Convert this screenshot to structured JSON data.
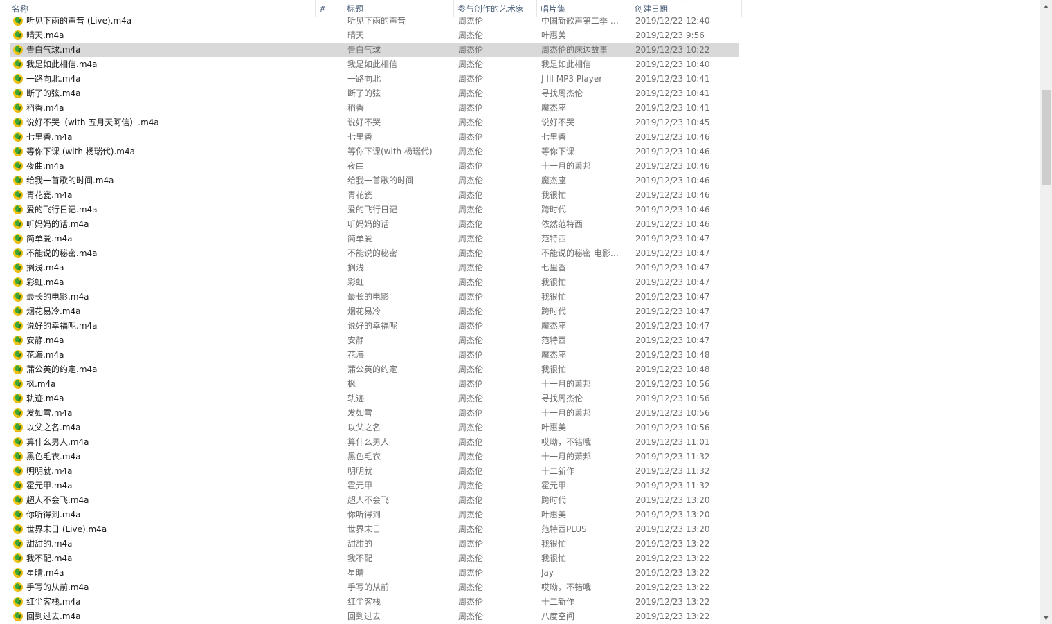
{
  "header": {
    "col_name": "名称",
    "col_number": "#",
    "col_title": "标题",
    "col_artists": "参与创作的艺术家",
    "col_album": "唱片集",
    "col_created": "创建日期",
    "sort_arrow": "⌃"
  },
  "scrollbar": {
    "up": "▲",
    "down": "▼",
    "position_fraction": 0.18
  },
  "colors": {
    "selected_row": "#d9d9d9",
    "header_text": "#4c607a",
    "icon": "qq-music-file-icon"
  },
  "rows": [
    {
      "name": "听见下雨的声音 (Live).m4a",
      "title": "听见下雨的声音",
      "artist": "周杰伦",
      "album": "中国新歌声第二季 第...",
      "date": "2019/12/22 12:40"
    },
    {
      "name": "晴天.m4a",
      "title": "晴天",
      "artist": "周杰伦",
      "album": "叶惠美",
      "date": "2019/12/23 9:56"
    },
    {
      "name": "告白气球.m4a",
      "title": "告白气球",
      "artist": "周杰伦",
      "album": "周杰伦的床边故事",
      "date": "2019/12/23 10:22",
      "selected": true
    },
    {
      "name": "我是如此相信.m4a",
      "title": "我是如此相信",
      "artist": "周杰伦",
      "album": "我是如此相信",
      "date": "2019/12/23 10:40"
    },
    {
      "name": "一路向北.m4a",
      "title": "一路向北",
      "artist": "周杰伦",
      "album": "J III MP3 Player",
      "date": "2019/12/23 10:41"
    },
    {
      "name": "断了的弦.m4a",
      "title": "断了的弦",
      "artist": "周杰伦",
      "album": "寻找周杰伦",
      "date": "2019/12/23 10:41"
    },
    {
      "name": "稻香.m4a",
      "title": "稻香",
      "artist": "周杰伦",
      "album": "魔杰座",
      "date": "2019/12/23 10:41"
    },
    {
      "name": "说好不哭（with 五月天阿信）.m4a",
      "title": "说好不哭",
      "artist": "周杰伦",
      "album": "说好不哭",
      "date": "2019/12/23 10:45"
    },
    {
      "name": "七里香.m4a",
      "title": "七里香",
      "artist": "周杰伦",
      "album": "七里香",
      "date": "2019/12/23 10:46"
    },
    {
      "name": "等你下课 (with 杨瑞代).m4a",
      "title": "等你下课(with 杨瑞代)",
      "artist": "周杰伦",
      "album": "等你下课",
      "date": "2019/12/23 10:46"
    },
    {
      "name": "夜曲.m4a",
      "title": "夜曲",
      "artist": "周杰伦",
      "album": "十一月的萧邦",
      "date": "2019/12/23 10:46"
    },
    {
      "name": "给我一首歌的时间.m4a",
      "title": "给我一首歌的时间",
      "artist": "周杰伦",
      "album": "魔杰座",
      "date": "2019/12/23 10:46"
    },
    {
      "name": "青花瓷.m4a",
      "title": "青花瓷",
      "artist": "周杰伦",
      "album": "我很忙",
      "date": "2019/12/23 10:46"
    },
    {
      "name": "爱的飞行日记.m4a",
      "title": "爱的飞行日记",
      "artist": "周杰伦",
      "album": "跨时代",
      "date": "2019/12/23 10:46"
    },
    {
      "name": "听妈妈的话.m4a",
      "title": "听妈妈的话",
      "artist": "周杰伦",
      "album": "依然范特西",
      "date": "2019/12/23 10:46"
    },
    {
      "name": "简单爱.m4a",
      "title": "简单爱",
      "artist": "周杰伦",
      "album": "范特西",
      "date": "2019/12/23 10:47"
    },
    {
      "name": "不能说的秘密.m4a",
      "title": "不能说的秘密",
      "artist": "周杰伦",
      "album": "不能说的秘密 电影原...",
      "date": "2019/12/23 10:47"
    },
    {
      "name": "搁浅.m4a",
      "title": "搁浅",
      "artist": "周杰伦",
      "album": "七里香",
      "date": "2019/12/23 10:47"
    },
    {
      "name": "彩虹.m4a",
      "title": "彩虹",
      "artist": "周杰伦",
      "album": "我很忙",
      "date": "2019/12/23 10:47"
    },
    {
      "name": "最长的电影.m4a",
      "title": "最长的电影",
      "artist": "周杰伦",
      "album": "我很忙",
      "date": "2019/12/23 10:47"
    },
    {
      "name": "烟花易冷.m4a",
      "title": "烟花易冷",
      "artist": "周杰伦",
      "album": "跨时代",
      "date": "2019/12/23 10:47"
    },
    {
      "name": "说好的幸福呢.m4a",
      "title": "说好的幸福呢",
      "artist": "周杰伦",
      "album": "魔杰座",
      "date": "2019/12/23 10:47"
    },
    {
      "name": "安静.m4a",
      "title": "安静",
      "artist": "周杰伦",
      "album": "范特西",
      "date": "2019/12/23 10:47"
    },
    {
      "name": "花海.m4a",
      "title": "花海",
      "artist": "周杰伦",
      "album": "魔杰座",
      "date": "2019/12/23 10:48"
    },
    {
      "name": "蒲公英的约定.m4a",
      "title": "蒲公英的约定",
      "artist": "周杰伦",
      "album": "我很忙",
      "date": "2019/12/23 10:48"
    },
    {
      "name": "枫.m4a",
      "title": "枫",
      "artist": "周杰伦",
      "album": "十一月的萧邦",
      "date": "2019/12/23 10:56"
    },
    {
      "name": "轨迹.m4a",
      "title": "轨迹",
      "artist": "周杰伦",
      "album": "寻找周杰伦",
      "date": "2019/12/23 10:56"
    },
    {
      "name": "发如雪.m4a",
      "title": "发如雪",
      "artist": "周杰伦",
      "album": "十一月的萧邦",
      "date": "2019/12/23 10:56"
    },
    {
      "name": "以父之名.m4a",
      "title": "以父之名",
      "artist": "周杰伦",
      "album": "叶惠美",
      "date": "2019/12/23 10:56"
    },
    {
      "name": "算什么男人.m4a",
      "title": "算什么男人",
      "artist": "周杰伦",
      "album": "哎呦，不错哦",
      "date": "2019/12/23 11:01"
    },
    {
      "name": "黑色毛衣.m4a",
      "title": "黑色毛衣",
      "artist": "周杰伦",
      "album": "十一月的萧邦",
      "date": "2019/12/23 11:32"
    },
    {
      "name": "明明就.m4a",
      "title": "明明就",
      "artist": "周杰伦",
      "album": "十二新作",
      "date": "2019/12/23 11:32"
    },
    {
      "name": "霍元甲.m4a",
      "title": "霍元甲",
      "artist": "周杰伦",
      "album": "霍元甲",
      "date": "2019/12/23 11:32"
    },
    {
      "name": "超人不会飞.m4a",
      "title": "超人不会飞",
      "artist": "周杰伦",
      "album": "跨时代",
      "date": "2019/12/23 13:20"
    },
    {
      "name": "你听得到.m4a",
      "title": "你听得到",
      "artist": "周杰伦",
      "album": "叶惠美",
      "date": "2019/12/23 13:20"
    },
    {
      "name": "世界末日 (Live).m4a",
      "title": "世界末日",
      "artist": "周杰伦",
      "album": "范特西PLUS",
      "date": "2019/12/23 13:20"
    },
    {
      "name": "甜甜的.m4a",
      "title": "甜甜的",
      "artist": "周杰伦",
      "album": "我很忙",
      "date": "2019/12/23 13:22"
    },
    {
      "name": "我不配.m4a",
      "title": "我不配",
      "artist": "周杰伦",
      "album": "我很忙",
      "date": "2019/12/23 13:22"
    },
    {
      "name": "星晴.m4a",
      "title": "星晴",
      "artist": "周杰伦",
      "album": "Jay",
      "date": "2019/12/23 13:22"
    },
    {
      "name": "手写的从前.m4a",
      "title": "手写的从前",
      "artist": "周杰伦",
      "album": "哎呦，不错哦",
      "date": "2019/12/23 13:22"
    },
    {
      "name": "红尘客栈.m4a",
      "title": "红尘客栈",
      "artist": "周杰伦",
      "album": "十二新作",
      "date": "2019/12/23 13:22"
    },
    {
      "name": "回到过去.m4a",
      "title": "回到过去",
      "artist": "周杰伦",
      "album": "八度空间",
      "date": "2019/12/23 13:22"
    }
  ]
}
